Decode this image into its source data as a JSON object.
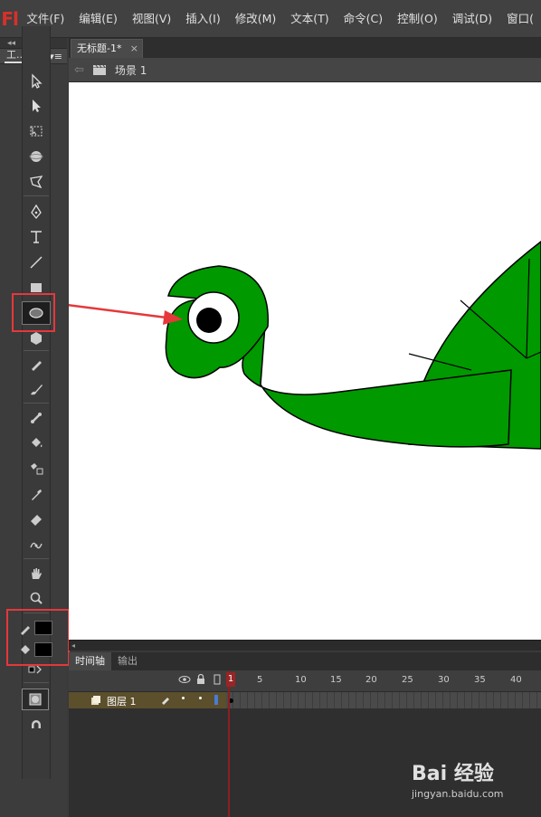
{
  "app": {
    "logo_text": "Fl"
  },
  "menu": [
    "文件(F)",
    "编辑(E)",
    "视图(V)",
    "插入(I)",
    "修改(M)",
    "文本(T)",
    "命令(C)",
    "控制(O)",
    "调试(D)",
    "窗口("
  ],
  "tools_panel": {
    "tab_label": "工...",
    "collapse": "◂◂",
    "menu_glyph": "▾≡"
  },
  "document": {
    "tab_title": "无标题-1*",
    "close": "×"
  },
  "edit_bar": {
    "back_glyph": "⇦",
    "scene_label": "场景 1"
  },
  "timeline": {
    "tabs": [
      "时间轴",
      "输出"
    ],
    "frame_numbers": [
      "1",
      "5",
      "10",
      "15",
      "20",
      "25",
      "30",
      "35",
      "40"
    ],
    "layer": {
      "name": "图层 1"
    },
    "current_frame": "1"
  },
  "stroke_color": "#000000",
  "fill_color": "#000000",
  "artwork_fill": "#009900",
  "highlight_color": "#e5383b",
  "watermark": {
    "logo": "Bai 经验",
    "url": "jingyan.baidu.com"
  }
}
